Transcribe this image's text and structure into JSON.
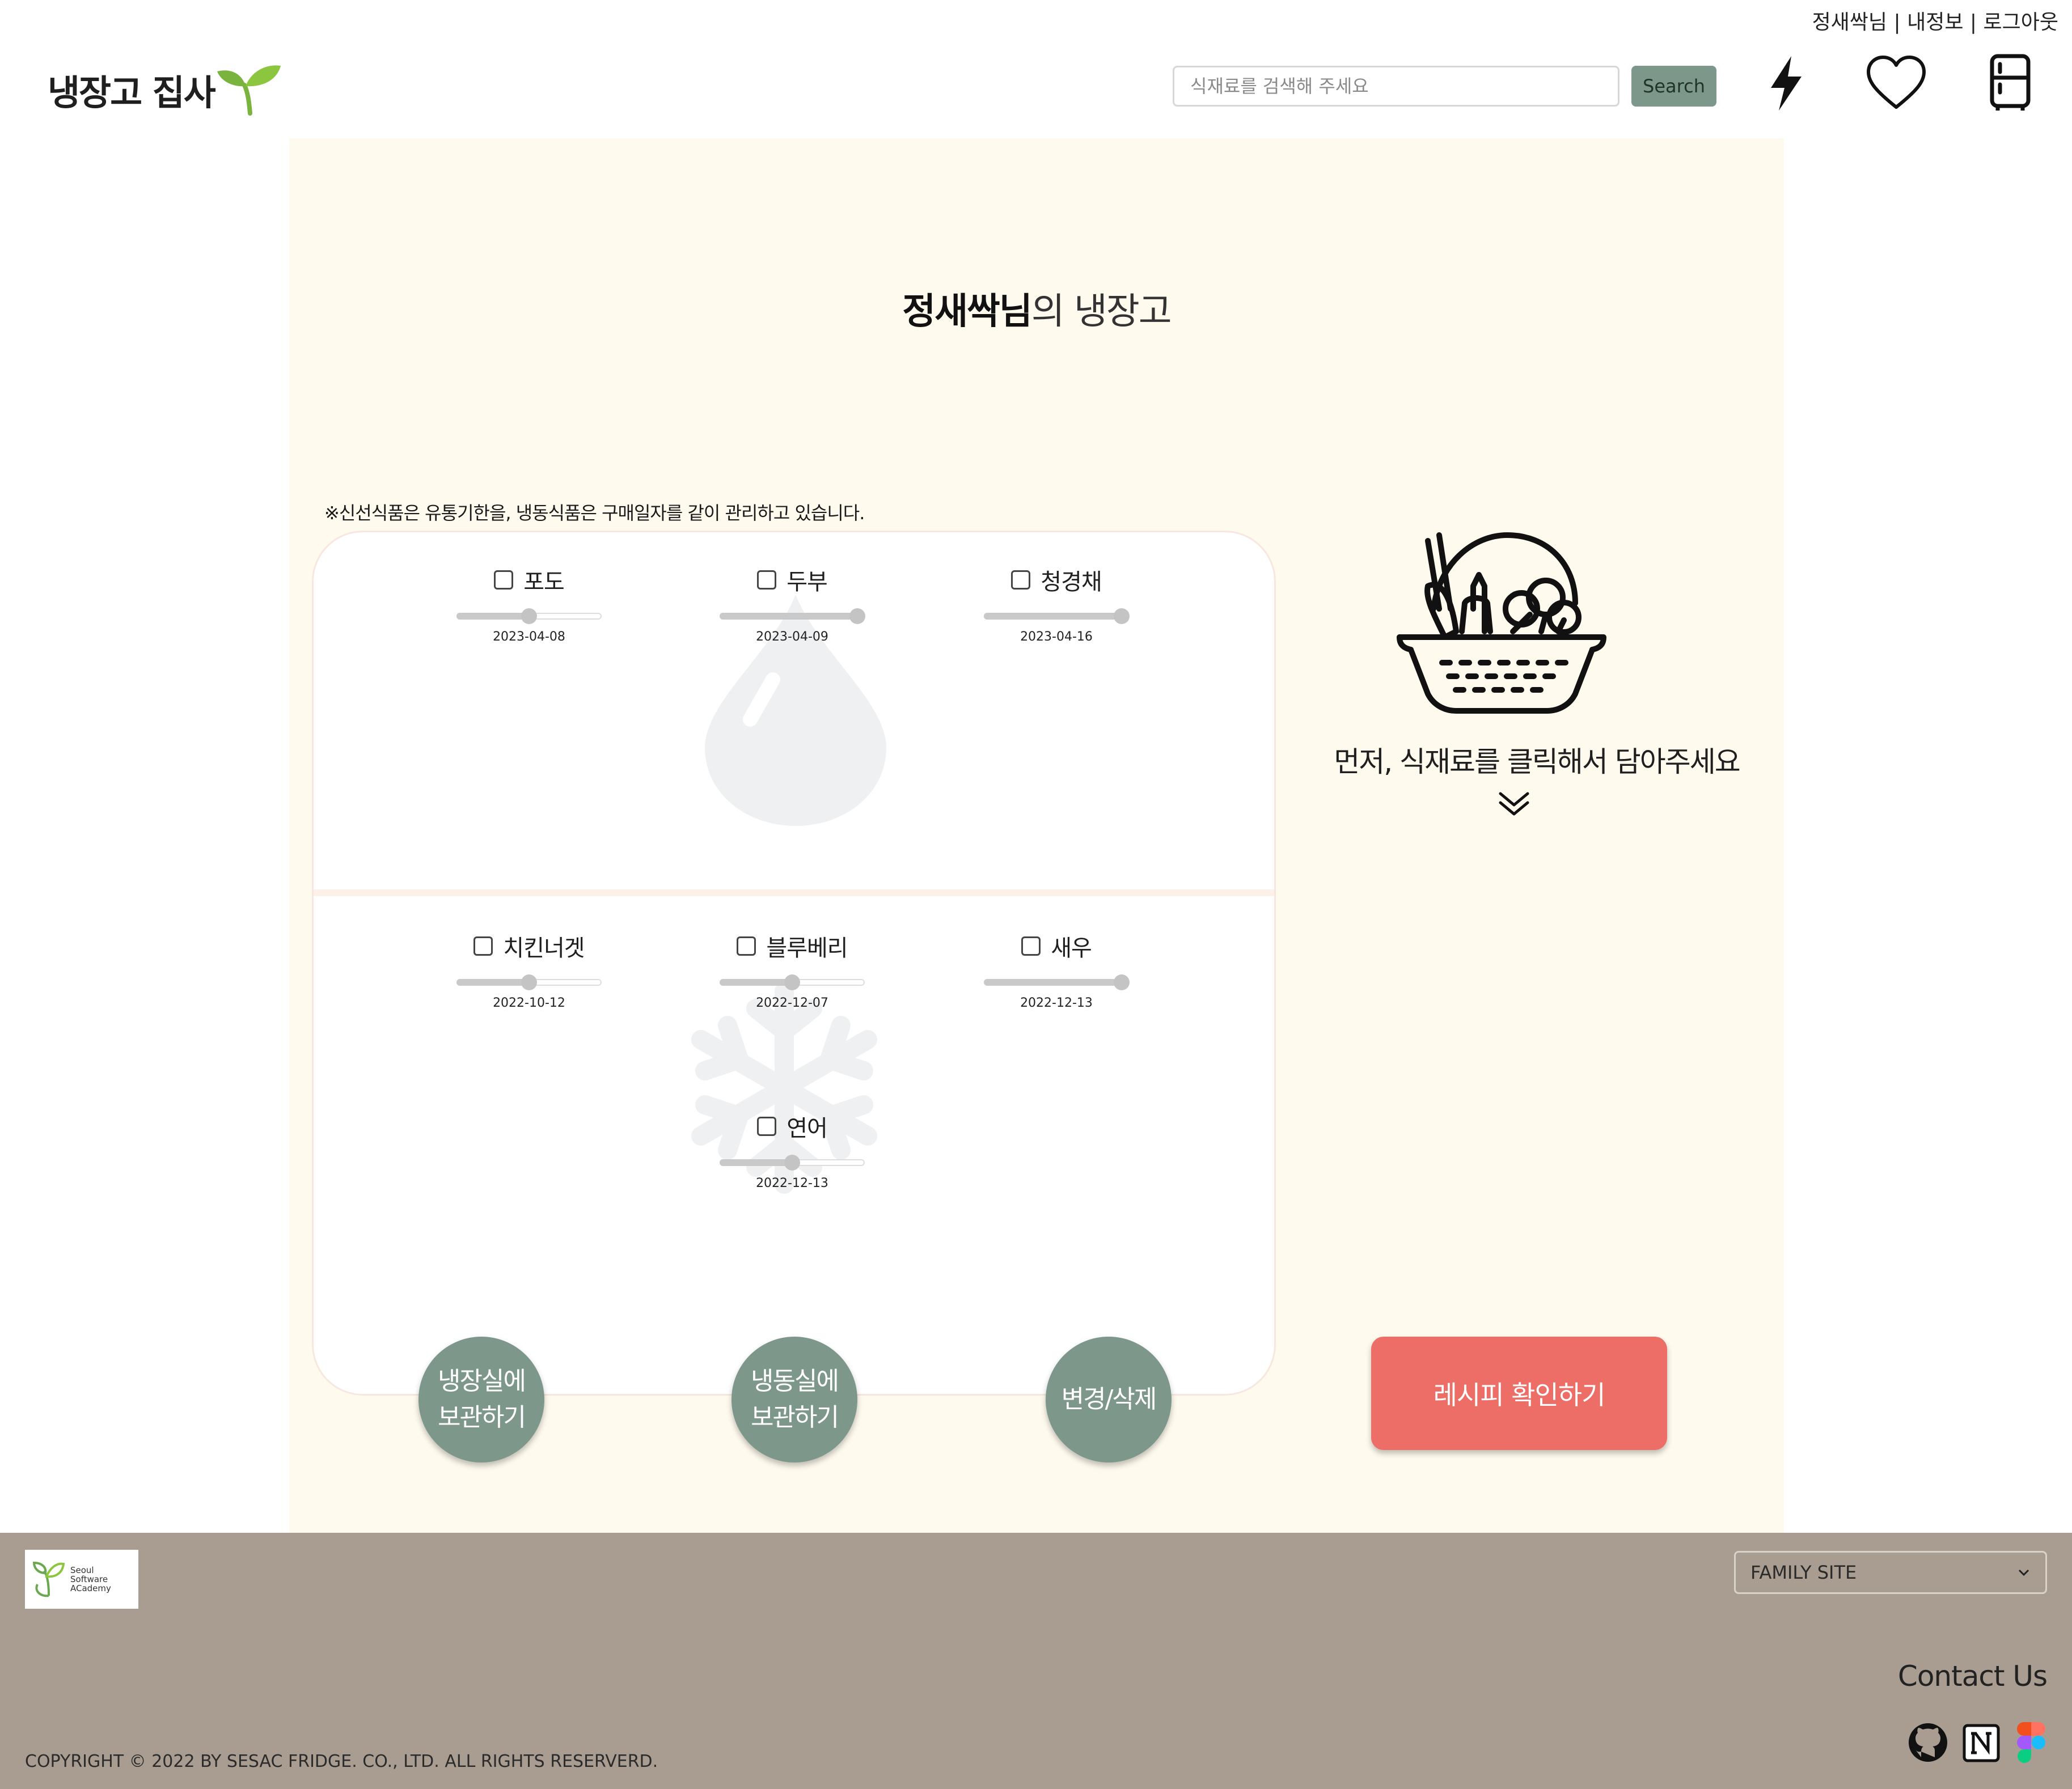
{
  "topbar": {
    "user": "정새싹님",
    "sep": "|",
    "myinfo": "내정보",
    "logout": "로그아웃"
  },
  "header": {
    "logo": "냉장고 집사",
    "search_placeholder": "식재료를 검색해 주세요",
    "search_button": "Search",
    "icons": [
      "lightning-icon",
      "heart-icon",
      "fridge-icon"
    ]
  },
  "main": {
    "title_bold": "정새싹님",
    "title_rest": "의 냉장고",
    "notice": "※신선식품은 유통기한을, 냉동식품은 구매일자를 같이 관리하고 있습니다.",
    "fridge_items": [
      {
        "name": "포도",
        "date": "2023-04-08",
        "progress": 0.5
      },
      {
        "name": "두부",
        "date": "2023-04-09",
        "progress": 0.95
      },
      {
        "name": "청경채",
        "date": "2023-04-16",
        "progress": 0.95
      }
    ],
    "freezer_items": [
      {
        "name": "치킨너겟",
        "date": "2022-10-12",
        "progress": 0.5
      },
      {
        "name": "블루베리",
        "date": "2022-12-07",
        "progress": 0.5
      },
      {
        "name": "새우",
        "date": "2022-12-13",
        "progress": 0.95
      },
      {
        "name": "연어",
        "date": "2022-12-13",
        "progress": 0.5
      }
    ],
    "guide": "먼저, 식재료를 클릭해서 담아주세요",
    "buttons": {
      "fridge": "냉장실에\n보관하기",
      "freezer": "냉동실에\n보관하기",
      "edit": "변경/삭제",
      "recipe": "레시피 확인하기"
    }
  },
  "footer": {
    "sesac_lines": [
      "Seoul",
      "Software",
      "ACademy"
    ],
    "family_site": "FAMILY SITE",
    "contact": "Contact Us",
    "copyright": "COPYRIGHT © 2022 BY SESAC FRIDGE. CO., LTD. ALL RIGHTS RESERVERD.",
    "social": [
      "github-icon",
      "notion-icon",
      "figma-icon"
    ]
  },
  "colors": {
    "accent": "#7e978b",
    "recipe": "#ec6e67",
    "panel": "#fefaee",
    "footer": "#a89d90"
  }
}
